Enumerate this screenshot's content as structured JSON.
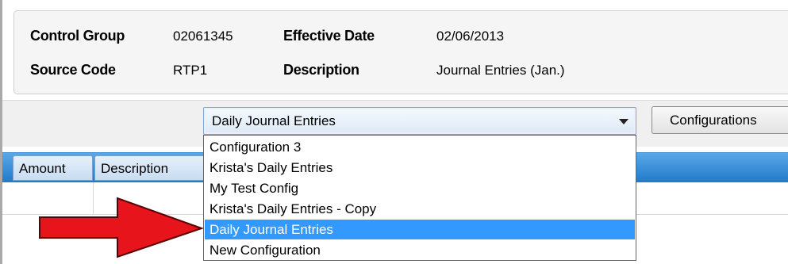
{
  "header": {
    "control_group_label": "Control Group",
    "control_group_value": "02061345",
    "effective_date_label": "Effective Date",
    "effective_date_value": "02/06/2013",
    "source_code_label": "Source Code",
    "source_code_value": "RTP1",
    "description_label": "Description",
    "description_value": "Journal Entries (Jan.)"
  },
  "toolbar": {
    "configuration_select_value": "Daily Journal Entries",
    "configurations_button_label": "Configurations"
  },
  "grid": {
    "columns": [
      "Amount",
      "Description"
    ]
  },
  "dropdown": {
    "options": [
      "Configuration 3",
      "Krista's Daily Entries",
      "My Test Config",
      "Krista's Daily Entries - Copy",
      "Daily Journal Entries",
      "New Configuration"
    ],
    "selected_index": 4
  },
  "colors": {
    "selection": "#3399ff",
    "grid_header": "#1f79c9",
    "callout_arrow": "#e8141c"
  },
  "icons": {
    "combo_arrow": "chevron-down-icon",
    "callout": "red-arrow-icon"
  }
}
